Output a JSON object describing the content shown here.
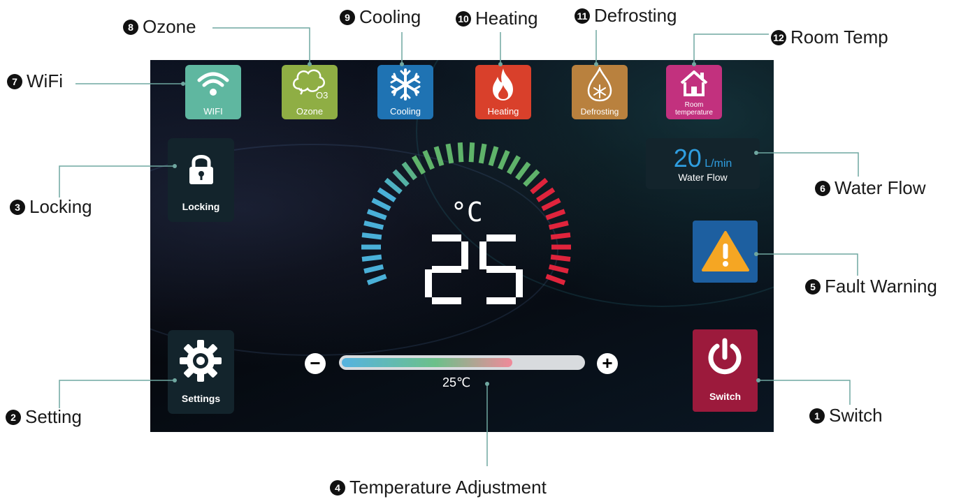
{
  "callouts": {
    "c1": {
      "num": "1",
      "label": "Switch"
    },
    "c2": {
      "num": "2",
      "label": "Setting"
    },
    "c3": {
      "num": "3",
      "label": "Locking"
    },
    "c4": {
      "num": "4",
      "label": "Temperature Adjustment"
    },
    "c5": {
      "num": "5",
      "label": "Fault Warning"
    },
    "c6": {
      "num": "6",
      "label": "Water Flow"
    },
    "c7": {
      "num": "7",
      "label": "WiFi"
    },
    "c8": {
      "num": "8",
      "label": "Ozone"
    },
    "c9": {
      "num": "9",
      "label": "Cooling"
    },
    "c10": {
      "num": "10",
      "label": "Heating"
    },
    "c11": {
      "num": "11",
      "label": "Defrosting"
    },
    "c12": {
      "num": "12",
      "label": "Room Temp"
    }
  },
  "tiles": {
    "wifi": {
      "label": "WIFI",
      "color": "#5fb7a0"
    },
    "ozone": {
      "label": "Ozone",
      "sub": "O3",
      "color": "#8fae44"
    },
    "cooling": {
      "label": "Cooling",
      "color": "#1f73b3"
    },
    "heating": {
      "label": "Heating",
      "color": "#d9402b"
    },
    "defrosting": {
      "label": "Defrosting",
      "color": "#b9813e"
    },
    "room": {
      "label": "Room temperature",
      "color": "#c2317e"
    }
  },
  "buttons": {
    "locking": "Locking",
    "settings": "Settings",
    "switch": "Switch",
    "switch_color": "#9c1a3c",
    "warning_color": "#1d5fa0"
  },
  "water_flow": {
    "value": "20",
    "unit": "L/min",
    "label": "Water Flow"
  },
  "temperature": {
    "unit": "°C",
    "display": "25",
    "slider_label": "25℃",
    "slider_level_percent": 71,
    "minus": "−",
    "plus": "+"
  },
  "gauge_colors": {
    "cold": "#4ab0d8",
    "mid": "#5fb36a",
    "hot": "#e0243c"
  }
}
